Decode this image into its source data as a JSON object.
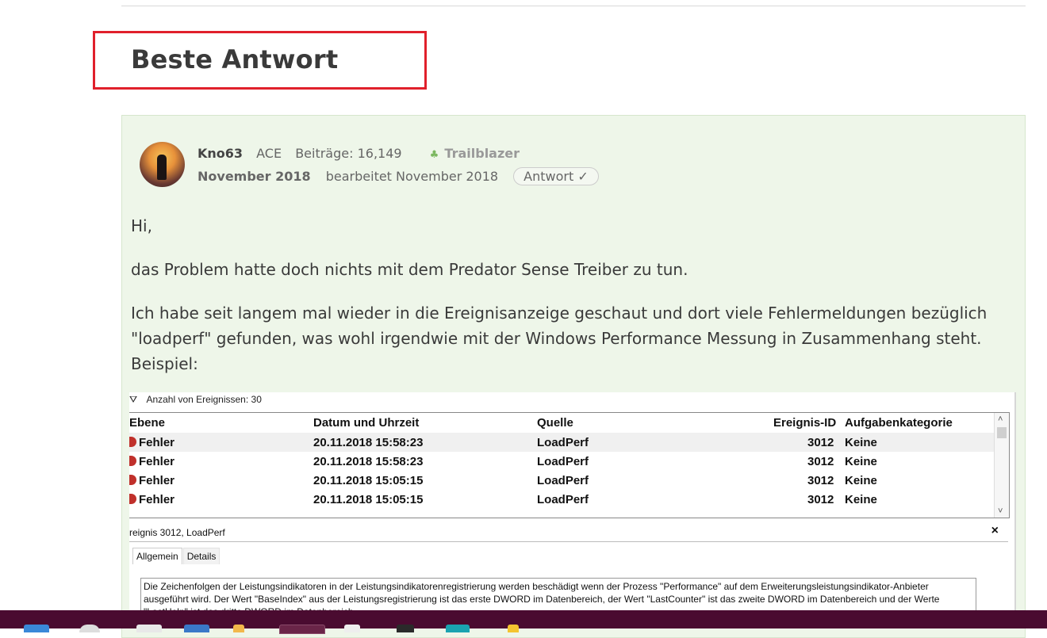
{
  "best_answer": {
    "title": "Beste Antwort"
  },
  "post": {
    "author": "Kno63",
    "role": "ACE",
    "posts": "Beiträge: 16,149",
    "badge": "Trailblazer",
    "badge_icon": "ACE",
    "date": "November 2018",
    "edited": "bearbeitet November 2018",
    "answer_tag": "Antwort ✓",
    "paragraphs": [
      "Hi,",
      "das Problem hatte doch nichts mit dem Predator Sense Treiber zu tun.",
      "Ich habe seit langem mal wieder in die Ereignisanzeige geschaut und dort viele Fehlermeldungen bezüglich \"loadperf\" gefunden, was wohl irgendwie mit der Windows Performance Messung in Zusammenhang steht. Beispiel:"
    ]
  },
  "event_viewer": {
    "filter_text": "Anzahl von Ereignissen: 30",
    "columns": [
      "Ebene",
      "Datum und Uhrzeit",
      "Quelle",
      "Ereignis-ID",
      "Aufgabenkategorie"
    ],
    "rows": [
      {
        "level": "Fehler",
        "datetime": "20.11.2018 15:58:23",
        "source": "LoadPerf",
        "id": "3012",
        "category": "Keine"
      },
      {
        "level": "Fehler",
        "datetime": "20.11.2018 15:58:23",
        "source": "LoadPerf",
        "id": "3012",
        "category": "Keine"
      },
      {
        "level": "Fehler",
        "datetime": "20.11.2018 15:05:15",
        "source": "LoadPerf",
        "id": "3012",
        "category": "Keine"
      },
      {
        "level": "Fehler",
        "datetime": "20.11.2018 15:05:15",
        "source": "LoadPerf",
        "id": "3012",
        "category": "Keine"
      }
    ],
    "detail_title": "reignis 3012, LoadPerf",
    "tabs": [
      "Allgemein",
      "Details"
    ],
    "description": "Die Zeichenfolgen der Leistungsindikatoren in der Leistungsindikatorenregistrierung werden beschädigt wenn der Prozess \"Performance\" auf dem Erweiterungsleistungsindikator-Anbieter ausgeführt wird. Der Wert \"BaseIndex\" aus der Leistungsregistrierung ist das erste DWORD im Datenbereich, der Wert \"LastCounter\" ist das zweite DWORD im Datenbereich und der Werte \"LastHelp\" ist das dritte DWORD im Datenbereich."
  },
  "colors": {
    "highlight_border": "#e0202b",
    "post_bg": "#eef6e9",
    "taskbar_bg": "#4a0b30"
  }
}
